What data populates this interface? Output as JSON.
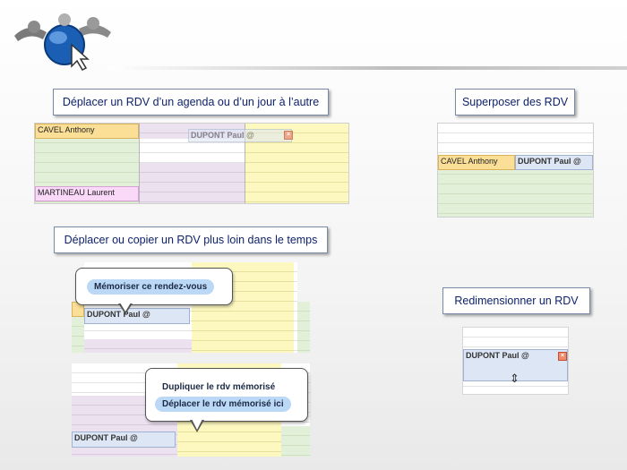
{
  "labels": {
    "move": "Déplacer un RDV  d’un agenda ou d’un jour à l’autre",
    "superpose": "Superposer des RDV",
    "copy": "Déplacer ou copier un RDV plus loin dans le temps",
    "resize": "Redimensionner un RDV"
  },
  "appointments": {
    "cavel": "CAVEL Anthony",
    "martineau": "MARTINEAU Laurent",
    "dupont": "DUPONT Paul @"
  },
  "menus": {
    "memorize": "Mémoriser ce rendez-vous",
    "duplicate": "Dupliquer le rdv mémorisé",
    "move_here": "Déplacer le rdv mémorisé ici"
  },
  "icons": {
    "close": "×",
    "resize": "⇕"
  },
  "colors": {
    "label_text": "#0b1f6b",
    "appt_blue": "#dde6f4",
    "appt_orange": "#fbdf96",
    "appt_pink": "#f9d8f8",
    "menu_highlight": "#bcd8f7"
  }
}
